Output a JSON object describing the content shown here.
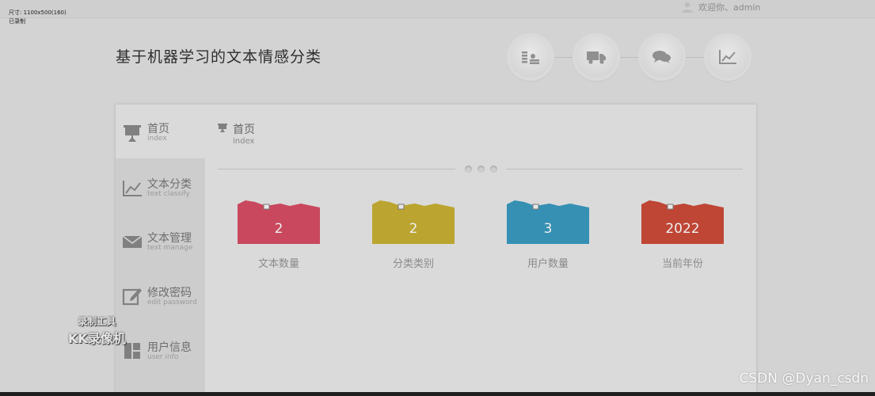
{
  "recorder": {
    "line1": "尺寸: 1100x500(160)",
    "line2": "已录制"
  },
  "header": {
    "welcome": "欢迎你、admin",
    "title": "基于机器学习的文本情感分类"
  },
  "quick_nav": [
    {
      "icon": "coins-icon"
    },
    {
      "icon": "truck-icon"
    },
    {
      "icon": "chat-icon"
    },
    {
      "icon": "line-chart-icon"
    }
  ],
  "sidebar": {
    "items": [
      {
        "zh": "首页",
        "en": "index",
        "icon": "presentation-icon",
        "active": true
      },
      {
        "zh": "文本分类",
        "en": "text classify",
        "icon": "line-chart-icon"
      },
      {
        "zh": "文本管理",
        "en": "text manage",
        "icon": "envelope-icon"
      },
      {
        "zh": "修改密码",
        "en": "edit password",
        "icon": "edit-icon"
      },
      {
        "zh": "用户信息",
        "en": "user info",
        "icon": "user-info-icon"
      }
    ]
  },
  "breadcrumb": {
    "zh": "首页",
    "en": "index"
  },
  "stats": [
    {
      "value": "2",
      "label": "文本数量",
      "color": "#c9485d"
    },
    {
      "value": "2",
      "label": "分类类别",
      "color": "#bba42f"
    },
    {
      "value": "3",
      "label": "用户数量",
      "color": "#3590b4"
    },
    {
      "value": "2022",
      "label": "当前年份",
      "color": "#bf4535"
    }
  ],
  "watermark": {
    "line1": "录制工具",
    "line2": "KK录像机"
  },
  "footer_credit": "CSDN @Dyan_csdn"
}
